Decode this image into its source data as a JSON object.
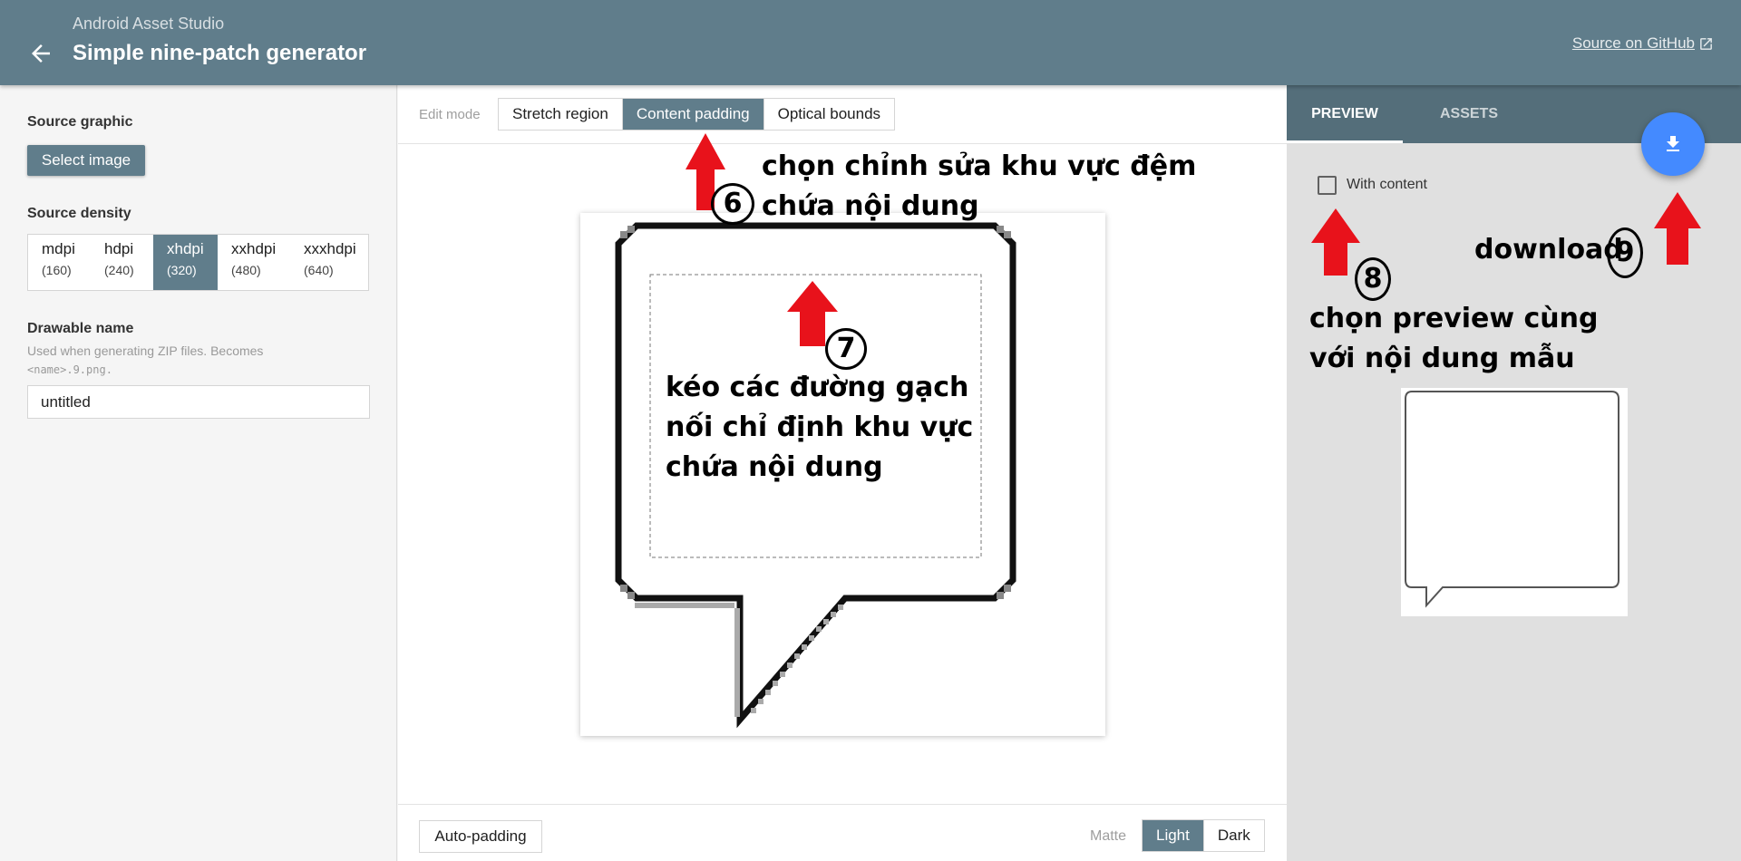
{
  "header": {
    "app_name": "Android Asset Studio",
    "title": "Simple nine-patch generator",
    "github_link": "Source on GitHub",
    "back_icon": "arrow-back-icon",
    "external_icon": "open-in-new-icon",
    "bg_color": "#607d8b"
  },
  "left": {
    "source_graphic_label": "Source graphic",
    "select_image_button": "Select image",
    "source_density_label": "Source density",
    "densities": [
      {
        "name": "mdpi",
        "value": "(160)"
      },
      {
        "name": "hdpi",
        "value": "(240)"
      },
      {
        "name": "xhdpi",
        "value": "(320)"
      },
      {
        "name": "xxhdpi",
        "value": "(480)"
      },
      {
        "name": "xxxhdpi",
        "value": "(640)"
      }
    ],
    "selected_density": "xhdpi",
    "drawable_name_label": "Drawable name",
    "drawable_hint_1": "Used when generating ZIP files. Becomes",
    "drawable_hint_2": "<name>.9.png.",
    "drawable_name_value": "untitled"
  },
  "editor": {
    "edit_mode_label": "Edit mode",
    "modes": [
      "Stretch region",
      "Content padding",
      "Optical bounds"
    ],
    "selected_mode": "Content padding",
    "auto_padding_button": "Auto-padding",
    "matte_label": "Matte",
    "matte_options": [
      "Light",
      "Dark"
    ],
    "selected_matte": "Light"
  },
  "right": {
    "tabs": [
      "PREVIEW",
      "ASSETS"
    ],
    "active_tab": "PREVIEW",
    "with_content_label": "With content",
    "with_content_checked": false,
    "download_icon": "download-icon",
    "fab_color": "#448aff"
  },
  "annotations": {
    "step6_line1": "chọn chỉnh sửa khu vực đệm",
    "step6_line2": "chứa nội dung",
    "step6_number": "6",
    "step7_line1": "kéo các đường gạch",
    "step7_line2": "nối chỉ định khu vực",
    "step7_line3": "chứa nội dung",
    "step7_number": "7",
    "step8_line1": "chọn preview cùng",
    "step8_line2": "với nội dung mẫu",
    "step8_number": "8",
    "step9_text": "download",
    "step9_number": "9",
    "arrow_color": "#e8121b"
  }
}
